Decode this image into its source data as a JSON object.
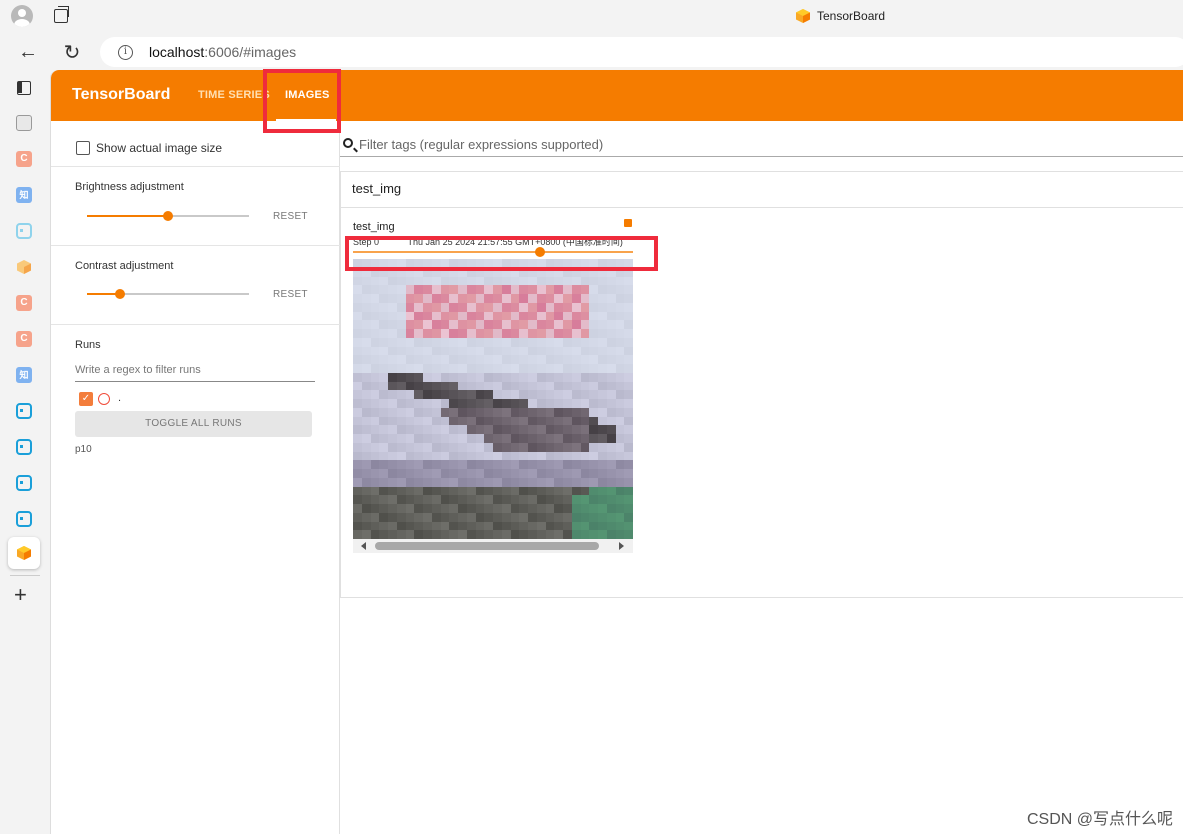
{
  "browser": {
    "tab_title": "TensorBoard",
    "url_host": "localhost",
    "url_rest": ":6006/#images",
    "info_glyph": "i",
    "icons": [
      "profile-icon",
      "workspaces-icon",
      "back-icon",
      "refresh-icon",
      "info-icon",
      "tensorboard-icon"
    ]
  },
  "edge_sidebar": {
    "items": [
      {
        "name": "sidebar-toggle-icon",
        "label": ""
      },
      {
        "name": "extension-icon",
        "label": ""
      },
      {
        "name": "csdn-icon",
        "label": "C"
      },
      {
        "name": "zhihu-icon",
        "label": "知"
      },
      {
        "name": "bilibili-icon",
        "label": ""
      },
      {
        "name": "tensorboard-icon",
        "label": ""
      },
      {
        "name": "csdn-icon",
        "label": "C"
      },
      {
        "name": "csdn-icon",
        "label": "C"
      },
      {
        "name": "zhihu-icon",
        "label": "知"
      },
      {
        "name": "bilibili-icon",
        "label": ""
      },
      {
        "name": "bilibili-icon",
        "label": ""
      },
      {
        "name": "bilibili-icon",
        "label": ""
      },
      {
        "name": "bilibili-icon",
        "label": ""
      }
    ],
    "add_label": "+"
  },
  "header": {
    "brand": "TensorBoard",
    "tabs": [
      {
        "label": "TIME SERIES",
        "active": false
      },
      {
        "label": "IMAGES",
        "active": true
      }
    ],
    "accent": "#f57c00"
  },
  "left_pane": {
    "show_actual_size_label": "Show actual image size",
    "show_actual_size_checked": false,
    "brightness_label": "Brightness adjustment",
    "brightness_value": 0.5,
    "contrast_label": "Contrast adjustment",
    "contrast_value": 0.2,
    "reset_label": "RESET",
    "runs_title": "Runs",
    "runs_filter_placeholder": "Write a regex to filter runs",
    "run_name": ".",
    "run_checked": true,
    "toggle_all_label": "TOGGLE ALL RUNS",
    "logdir": "p10"
  },
  "main": {
    "filter_placeholder": "Filter tags (regular expressions supported)",
    "group_title": "test_img",
    "card_title": "test_img",
    "step_label": "Step 0",
    "timestamp": "Thu Jan 25 2024 21:57:55 GMT+0800 (中国标准时间)",
    "step_position": 0.67
  },
  "annotations": {
    "highlight_color": "#ef2b3c"
  },
  "watermark": "CSDN @写点什么呢"
}
